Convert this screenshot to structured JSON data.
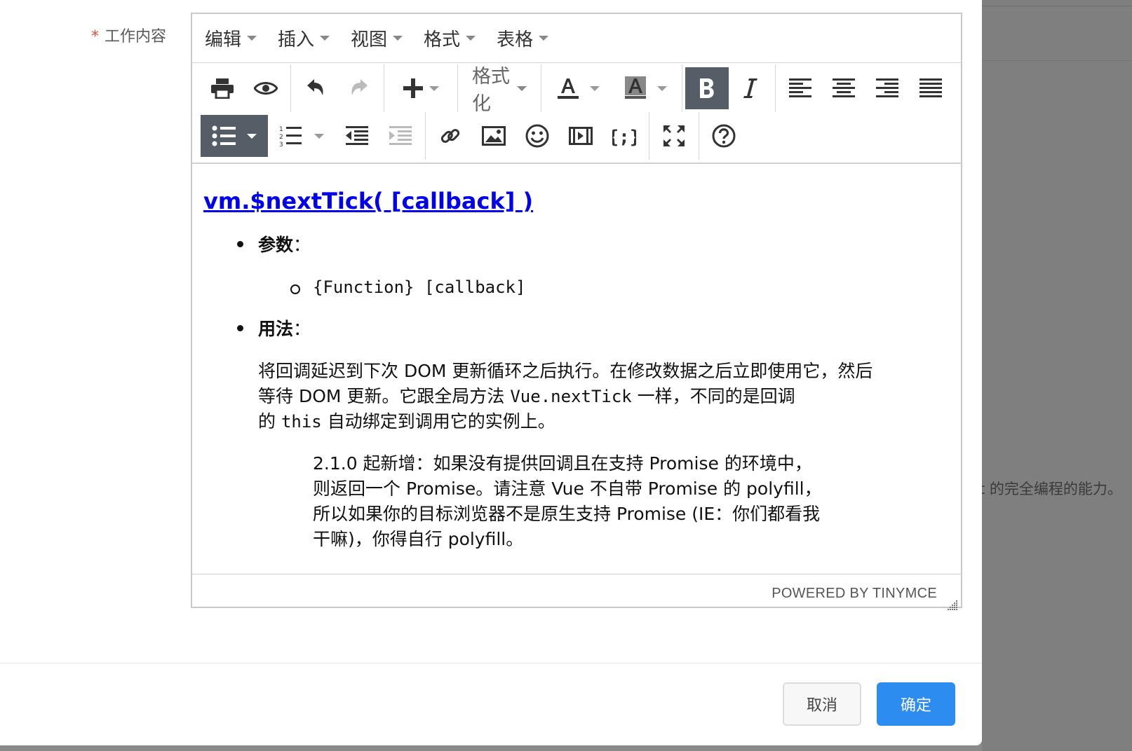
{
  "form": {
    "required_mark": "*",
    "label": "工作内容"
  },
  "editor": {
    "menubar": [
      "编辑",
      "插入",
      "视图",
      "格式",
      "表格"
    ],
    "toolbar": {
      "format_label": "格式化",
      "icons": [
        "print-icon",
        "preview-eye-icon",
        "undo-icon",
        "redo-icon",
        "insert-plus-icon",
        "font-color-icon",
        "background-color-icon",
        "bold-icon",
        "italic-icon",
        "align-left-icon",
        "align-center-icon",
        "align-right-icon",
        "align-justify-icon",
        "bullet-list-icon",
        "numbered-list-icon",
        "outdent-icon",
        "indent-icon",
        "link-icon",
        "image-icon",
        "emoticon-icon",
        "media-icon",
        "code-sample-icon",
        "fullscreen-icon",
        "help-icon"
      ]
    },
    "content": {
      "title": "vm.$nextTick( [callback] )",
      "params_label": "参数",
      "params_colon": "：",
      "param_item": "{Function} [callback]",
      "usage_label": "用法",
      "usage_colon": "：",
      "usage_p1a": "将回调延迟到下次 DOM 更新循环之后执行。在修改数据之后立即使用它，然后",
      "usage_p1b": "等待 DOM 更新。它跟全局方法 ",
      "usage_code1": "Vue.nextTick",
      "usage_p1c": " 一样，不同的是回调",
      "usage_p1d": "的 ",
      "usage_code2": "this",
      "usage_p1e": " 自动绑定到调用它的实例上。",
      "note_l1": "2.1.0 起新增：如果没有提供回调且在支持 Promise 的环境中，",
      "note_l2": "则返回一个 Promise。请注意 Vue 不自带 Promise 的 polyfill，",
      "note_l3": "所以如果你的目标浏览器不是原生支持 Promise (IE：你们都看我",
      "note_l4": "干嘛)，你得自行 polyfill。"
    },
    "statusbar": "POWERED BY TINYMCE"
  },
  "background": {
    "text": "t 的完全编程的能力。"
  },
  "footer": {
    "cancel": "取消",
    "ok": "确定"
  },
  "colors": {
    "primary": "#2d8cf0",
    "active_tool": "#555d66",
    "link": "#0000ee",
    "required": "#e64b3c"
  }
}
